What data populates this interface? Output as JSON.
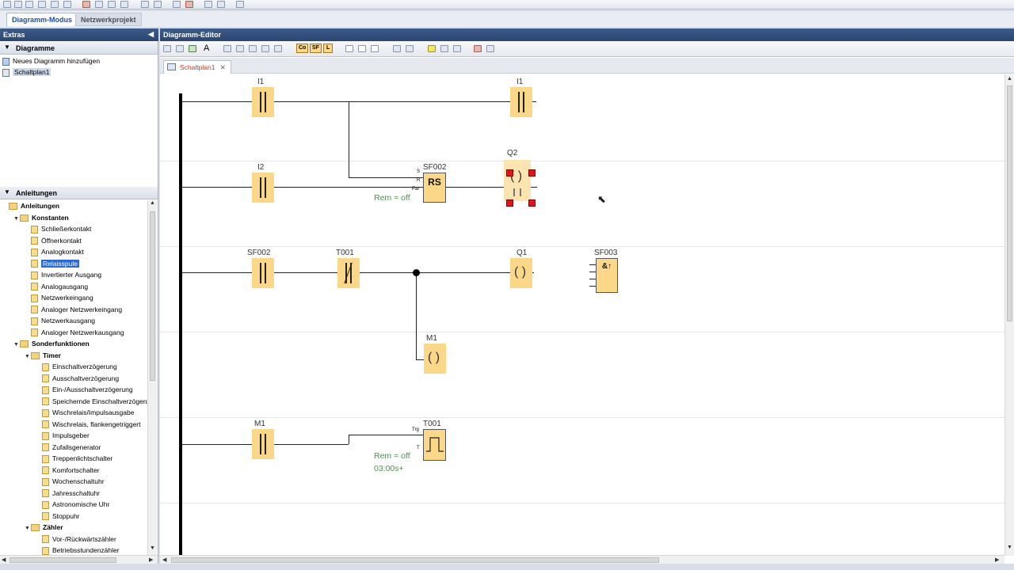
{
  "mode_tabs": [
    "Diagramm-Modus",
    "Netzwerkprojekt"
  ],
  "left": {
    "extras_title": "Extras",
    "diagrams_header": "Diagramme",
    "diagram_items": [
      "Neues Diagramm hinzufügen",
      "Schaltplan1"
    ],
    "tutorials_header": "Anleitungen",
    "tree": [
      {
        "label": "Anleitungen",
        "level": 0,
        "type": "folder",
        "bold": true
      },
      {
        "label": "Konstanten",
        "level": 1,
        "type": "folder",
        "bold": true,
        "expanded": true
      },
      {
        "label": "Schließerkontakt",
        "level": 2,
        "type": "item"
      },
      {
        "label": "Öffnerkontakt",
        "level": 2,
        "type": "item"
      },
      {
        "label": "Analogkontakt",
        "level": 2,
        "type": "item"
      },
      {
        "label": "Relaisspule",
        "level": 2,
        "type": "item",
        "selected": true
      },
      {
        "label": "Invertierter Ausgang",
        "level": 2,
        "type": "item"
      },
      {
        "label": "Analogausgang",
        "level": 2,
        "type": "item"
      },
      {
        "label": "Netzwerkeingang",
        "level": 2,
        "type": "item"
      },
      {
        "label": "Analoger Netzwerkeingang",
        "level": 2,
        "type": "item"
      },
      {
        "label": "Netzwerkausgang",
        "level": 2,
        "type": "item"
      },
      {
        "label": "Analoger Netzwerkausgang",
        "level": 2,
        "type": "item"
      },
      {
        "label": "Sonderfunktionen",
        "level": 1,
        "type": "folder",
        "bold": true,
        "expanded": true
      },
      {
        "label": "Timer",
        "level": 2,
        "type": "folder",
        "bold": true,
        "expanded": true
      },
      {
        "label": "Einschaltverzögerung",
        "level": 3,
        "type": "item"
      },
      {
        "label": "Ausschaltverzögerung",
        "level": 3,
        "type": "item"
      },
      {
        "label": "Ein-/Ausschaltverzögerung",
        "level": 3,
        "type": "item"
      },
      {
        "label": "Speichernde Einschaltverzögerung",
        "level": 3,
        "type": "item"
      },
      {
        "label": "Wischrelais/Impulsausgabe",
        "level": 3,
        "type": "item"
      },
      {
        "label": "Wischrelais, flankengetriggert",
        "level": 3,
        "type": "item"
      },
      {
        "label": "Impulsgeber",
        "level": 3,
        "type": "item"
      },
      {
        "label": "Zufallsgenerator",
        "level": 3,
        "type": "item"
      },
      {
        "label": "Treppenlichtschalter",
        "level": 3,
        "type": "item"
      },
      {
        "label": "Komfortschalter",
        "level": 3,
        "type": "item"
      },
      {
        "label": "Wochenschaltuhr",
        "level": 3,
        "type": "item"
      },
      {
        "label": "Jahresschaltuhr",
        "level": 3,
        "type": "item"
      },
      {
        "label": "Astronomische Uhr",
        "level": 3,
        "type": "item"
      },
      {
        "label": "Stoppuhr",
        "level": 3,
        "type": "item"
      },
      {
        "label": "Zähler",
        "level": 2,
        "type": "folder",
        "bold": true,
        "expanded": true
      },
      {
        "label": "Vor-/Rückwärtszähler",
        "level": 3,
        "type": "item"
      },
      {
        "label": "Betriebsstundenzähler",
        "level": 3,
        "type": "item"
      }
    ]
  },
  "editor": {
    "title": "Diagramm-Editor",
    "doc_tab": "Schaltplan1",
    "toolbar_buttons": [
      "Co",
      "SF",
      "L"
    ]
  },
  "diagram": {
    "labels": {
      "i1_a": "I1",
      "i1_b": "I1",
      "i2": "I2",
      "sf002_rs": "SF002",
      "rs_text": "RS",
      "q2": "Q2",
      "sf002_contact": "SF002",
      "t001_contact": "T001",
      "q1": "Q1",
      "sf003": "SF003",
      "and_text": "&↑",
      "m1_coil": "M1",
      "m1_contact": "M1",
      "t001_timer": "T001",
      "rs_s": "S",
      "rs_r": "R",
      "rs_par": "Par",
      "t_trg": "Trg",
      "t_t": "T",
      "rem1": "Rem = off",
      "rem2": "Rem = off",
      "time": "03:00s+"
    }
  }
}
